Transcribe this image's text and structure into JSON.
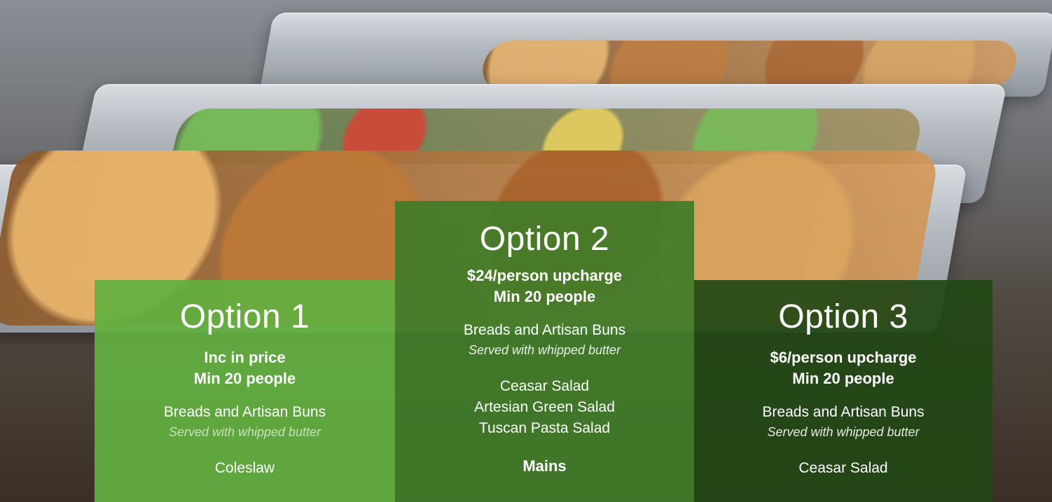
{
  "options": [
    {
      "title": "Option 1",
      "price": "Inc in price",
      "min": "Min 20 people",
      "breads": "Breads and Artisan Buns",
      "breads_note": "Served with whipped butter",
      "salads": [
        "Coleslaw"
      ]
    },
    {
      "title": "Option 2",
      "price": "$24/person upcharge",
      "min": "Min 20 people",
      "breads": "Breads and Artisan Buns",
      "breads_note": "Served with whipped butter",
      "salads": [
        "Ceasar Salad",
        "Artesian Green Salad",
        "Tuscan Pasta Salad"
      ],
      "mains_heading": "Mains"
    },
    {
      "title": "Option 3",
      "price": "$6/person upcharge",
      "min": "Min 20 people",
      "breads": "Breads and Artisan Buns",
      "breads_note": "Served with whipped butter",
      "salads": [
        "Ceasar Salad"
      ]
    }
  ]
}
